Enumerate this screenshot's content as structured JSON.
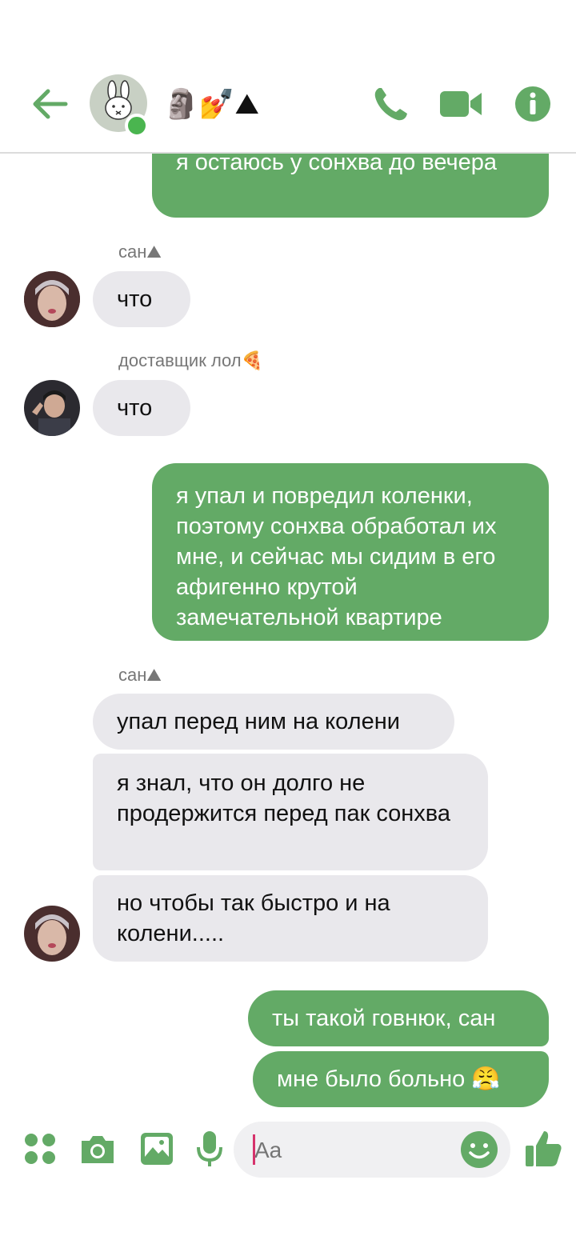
{
  "header": {
    "title": "🗿💅⛰",
    "icons": {
      "back": "back-arrow-icon",
      "call": "phone-icon",
      "video": "video-camera-icon",
      "info": "info-icon"
    },
    "accent": "#63aa66"
  },
  "messages": [
    {
      "kind": "out",
      "text": "я остаюсь у сонхва до вечера"
    },
    {
      "kind": "label",
      "text": "сан⛰"
    },
    {
      "kind": "in",
      "text": "что"
    },
    {
      "kind": "label",
      "text": "доставщик лол🍕"
    },
    {
      "kind": "in",
      "text": "что"
    },
    {
      "kind": "out",
      "text": "я упал и повредил коленки, поэтому сонхва обработал их мне, и сейчас мы сидим в его афигенно крутой замечательной квартире"
    },
    {
      "kind": "label",
      "text": "сан⛰"
    },
    {
      "kind": "in",
      "text": "упал перед ним на колени"
    },
    {
      "kind": "in",
      "text": "я знал, что он долго не продержится перед пак сонхва"
    },
    {
      "kind": "in",
      "text": "но чтобы так быстро и на колени....."
    },
    {
      "kind": "out",
      "text": "ты такой говнюк, сан"
    },
    {
      "kind": "out",
      "text": "мне было больно 😤"
    }
  ],
  "composer": {
    "placeholder": "Aa",
    "icons": [
      "apps-icon",
      "camera-icon",
      "gallery-icon",
      "microphone-icon",
      "emoji-icon",
      "thumbs-up-icon"
    ]
  }
}
